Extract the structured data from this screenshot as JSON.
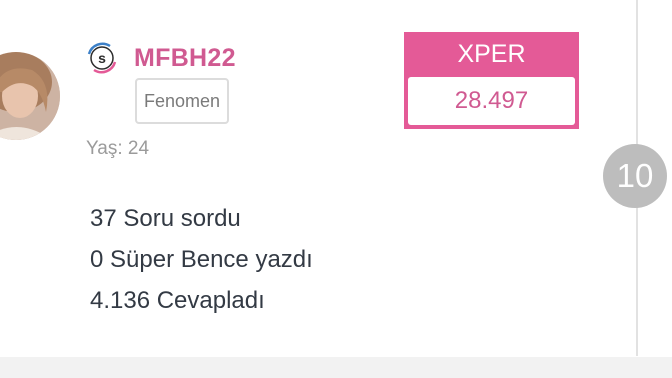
{
  "profile": {
    "username": "MFBH22",
    "rank": "Fenomen",
    "age_text": "Yaş: 24",
    "badge_icon": "s-badge-icon",
    "avatar_icon": "user-avatar"
  },
  "xper": {
    "label": "XPER",
    "value": "28.497"
  },
  "stats": {
    "questions": "37 Soru sordu",
    "super_opinions": "0 Süper Bence yazdı",
    "answers": "4.136 Cevapladı"
  },
  "counter": {
    "value": "10"
  },
  "colors": {
    "accent": "#e45a97",
    "username": "#d05a91",
    "badge_blue": "#3c80c8",
    "counter_bg": "#bdbdbd",
    "text_dark": "#333a44",
    "text_muted": "#9b9b9b"
  }
}
